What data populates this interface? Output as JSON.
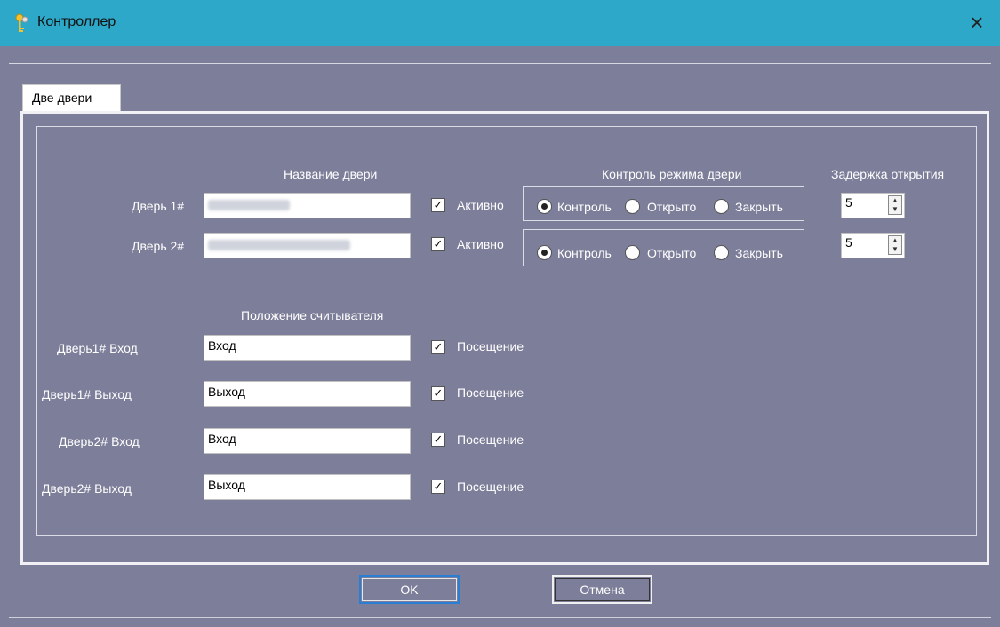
{
  "window": {
    "title": "Контроллер",
    "close_icon": "×"
  },
  "tab": {
    "label": "Две двери"
  },
  "headers": {
    "door_name": "Название двери",
    "door_mode": "Контроль режима двери",
    "open_delay": "Задержка открытия",
    "reader_position": "Положение считывателя"
  },
  "doors": [
    {
      "label": "Дверь 1#",
      "active_label": "Активно",
      "active_checked": true,
      "mode_options": [
        "Контроль",
        "Открыто",
        "Закрыть"
      ],
      "mode_selected": "Контроль",
      "delay": "5"
    },
    {
      "label": "Дверь 2#",
      "active_label": "Активно",
      "active_checked": true,
      "mode_options": [
        "Контроль",
        "Открыто",
        "Закрыть"
      ],
      "mode_selected": "Контроль",
      "delay": "5"
    }
  ],
  "readers": [
    {
      "label": "Дверь1# Вход",
      "value": "Вход",
      "visit_label": "Посещение",
      "checked": true
    },
    {
      "label": "Дверь1# Выход",
      "value": "Выход",
      "visit_label": "Посещение",
      "checked": true
    },
    {
      "label": "Дверь2# Вход",
      "value": "Вход",
      "visit_label": "Посещение",
      "checked": true
    },
    {
      "label": "Дверь2# Выход",
      "value": "Выход",
      "visit_label": "Посещение",
      "checked": true
    }
  ],
  "buttons": {
    "ok": "OK",
    "cancel": "Отмена"
  },
  "colors": {
    "titlebar": "#2ea8c8",
    "body": "#7d7e99",
    "ok_border": "#2a7fd4"
  }
}
